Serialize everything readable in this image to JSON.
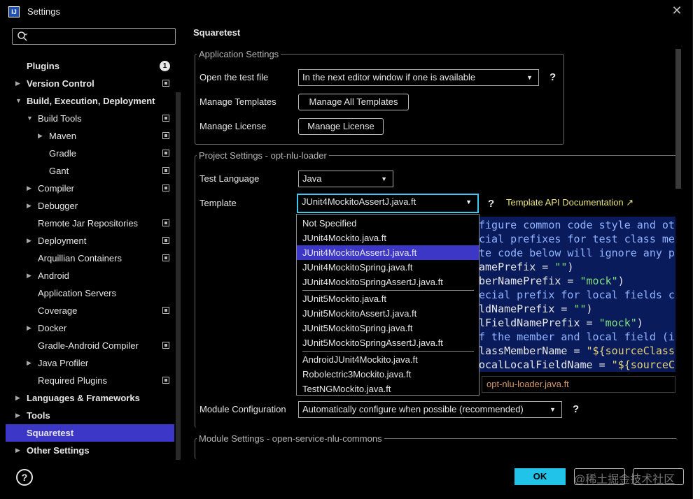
{
  "window": {
    "title": "Settings",
    "icon": "intellij-icon",
    "close": "✕"
  },
  "search": {
    "placeholder": ""
  },
  "sidebar": {
    "plugins_badge": "1",
    "items": [
      {
        "label": "Plugins",
        "bold": true,
        "indent": 0,
        "arrow": "",
        "icon": "badge"
      },
      {
        "label": "Version Control",
        "bold": true,
        "indent": 0,
        "arrow": "▶",
        "icon": "copy"
      },
      {
        "label": "Build, Execution, Deployment",
        "bold": true,
        "indent": 0,
        "arrow": "▼",
        "icon": ""
      },
      {
        "label": "Build Tools",
        "bold": false,
        "indent": 1,
        "arrow": "▼",
        "icon": "copy"
      },
      {
        "label": "Maven",
        "bold": false,
        "indent": 2,
        "arrow": "▶",
        "icon": "copy"
      },
      {
        "label": "Gradle",
        "bold": false,
        "indent": 2,
        "arrow": "",
        "icon": "copy"
      },
      {
        "label": "Gant",
        "bold": false,
        "indent": 2,
        "arrow": "",
        "icon": "copy"
      },
      {
        "label": "Compiler",
        "bold": false,
        "indent": 1,
        "arrow": "▶",
        "icon": "copy"
      },
      {
        "label": "Debugger",
        "bold": false,
        "indent": 1,
        "arrow": "▶",
        "icon": ""
      },
      {
        "label": "Remote Jar Repositories",
        "bold": false,
        "indent": 1,
        "arrow": "",
        "icon": "copy"
      },
      {
        "label": "Deployment",
        "bold": false,
        "indent": 1,
        "arrow": "▶",
        "icon": "copy"
      },
      {
        "label": "Arquillian Containers",
        "bold": false,
        "indent": 1,
        "arrow": "",
        "icon": "copy"
      },
      {
        "label": "Android",
        "bold": false,
        "indent": 1,
        "arrow": "▶",
        "icon": ""
      },
      {
        "label": "Application Servers",
        "bold": false,
        "indent": 1,
        "arrow": "",
        "icon": ""
      },
      {
        "label": "Coverage",
        "bold": false,
        "indent": 1,
        "arrow": "",
        "icon": "copy"
      },
      {
        "label": "Docker",
        "bold": false,
        "indent": 1,
        "arrow": "▶",
        "icon": ""
      },
      {
        "label": "Gradle-Android Compiler",
        "bold": false,
        "indent": 1,
        "arrow": "",
        "icon": "copy"
      },
      {
        "label": "Java Profiler",
        "bold": false,
        "indent": 1,
        "arrow": "▶",
        "icon": ""
      },
      {
        "label": "Required Plugins",
        "bold": false,
        "indent": 1,
        "arrow": "",
        "icon": "copy"
      },
      {
        "label": "Languages & Frameworks",
        "bold": true,
        "indent": 0,
        "arrow": "▶",
        "icon": ""
      },
      {
        "label": "Tools",
        "bold": true,
        "indent": 0,
        "arrow": "▶",
        "icon": ""
      },
      {
        "label": "Squaretest",
        "bold": true,
        "indent": 0,
        "arrow": "",
        "icon": "",
        "selected": true
      },
      {
        "label": "Other Settings",
        "bold": true,
        "indent": 0,
        "arrow": "▶",
        "icon": ""
      }
    ]
  },
  "main": {
    "title": "Squaretest",
    "app_settings": {
      "title": "Application Settings",
      "open_test_file_label": "Open the test file",
      "open_test_file_value": "In the next editor window if one is available",
      "manage_templates_label": "Manage Templates",
      "manage_templates_button": "Manage All Templates",
      "manage_license_label": "Manage License",
      "manage_license_button": "Manage License",
      "help": "?"
    },
    "project_settings": {
      "title": "Project Settings - opt-nlu-loader",
      "test_language_label": "Test Language",
      "test_language_value": "Java",
      "template_label": "Template",
      "template_value": "JUnit4MockitoAssertJ.java.ft",
      "template_api_link": "Template API Documentation ↗",
      "help": "?",
      "template_file": "opt-nlu-loader.java.ft",
      "module_config_label": "Module Configuration",
      "module_config_value": "Automatically configure when possible (recommended)"
    },
    "module_settings": {
      "title": "Module Settings - open-service-nlu-commons"
    },
    "code_lines": [
      {
        "parts": [
          {
            "t": "figure common code style and ot",
            "k": "c"
          }
        ]
      },
      {
        "parts": [
          {
            "t": "cial prefixes for test class me",
            "k": "c"
          }
        ]
      },
      {
        "parts": [
          {
            "t": "te code below will ignore any p",
            "k": "c"
          }
        ]
      },
      {
        "parts": [
          {
            "t": "amePrefix = ",
            "k": "n"
          },
          {
            "t": "\"\"",
            "k": "s"
          },
          {
            "t": ")",
            "k": "n"
          }
        ]
      },
      {
        "parts": [
          {
            "t": "berNamePrefix = ",
            "k": "n"
          },
          {
            "t": "\"mock\"",
            "k": "s"
          },
          {
            "t": ")",
            "k": "n"
          }
        ]
      },
      {
        "parts": [
          {
            "t": "ecial prefix for local fields c",
            "k": "c"
          }
        ]
      },
      {
        "parts": [
          {
            "t": "ldNamePrefix = ",
            "k": "n"
          },
          {
            "t": "\"\"",
            "k": "s"
          },
          {
            "t": ")",
            "k": "n"
          }
        ]
      },
      {
        "parts": [
          {
            "t": "lFieldNamePrefix = ",
            "k": "n"
          },
          {
            "t": "\"mock\"",
            "k": "s"
          },
          {
            "t": ")",
            "k": "n"
          }
        ]
      },
      {
        "parts": [
          {
            "t": "f the member and local field (i",
            "k": "c"
          }
        ]
      },
      {
        "parts": [
          {
            "t": "lassMemberName = ",
            "k": "n"
          },
          {
            "t": "\"${sourceClass",
            "k": "v"
          }
        ]
      },
      {
        "parts": [
          {
            "t": "ocalLocalFieldName = ",
            "k": "n"
          },
          {
            "t": "\"${sourceC",
            "k": "v"
          }
        ]
      }
    ],
    "template_options": [
      {
        "label": "Not Specified"
      },
      {
        "label": "JUnit4Mockito.java.ft"
      },
      {
        "label": "JUnit4MockitoAssertJ.java.ft",
        "selected": true
      },
      {
        "label": "JUnit4MockitoSpring.java.ft"
      },
      {
        "label": "JUnit4MockitoSpringAssertJ.java.ft",
        "sep_after": true
      },
      {
        "label": "JUnit5Mockito.java.ft"
      },
      {
        "label": "JUnit5MockitoAssertJ.java.ft"
      },
      {
        "label": "JUnit5MockitoSpring.java.ft"
      },
      {
        "label": "JUnit5MockitoSpringAssertJ.java.ft",
        "sep_after": true
      },
      {
        "label": "AndroidJUnit4Mockito.java.ft"
      },
      {
        "label": "Robolectric3Mockito.java.ft"
      },
      {
        "label": "TestNGMockito.java.ft"
      }
    ]
  },
  "footer": {
    "help": "?",
    "ok": "OK",
    "watermark": "@稀土掘金技术社区"
  },
  "colors": {
    "accent": "#22c3e8",
    "selection": "#3d37c7",
    "link": "#e9e37a"
  }
}
